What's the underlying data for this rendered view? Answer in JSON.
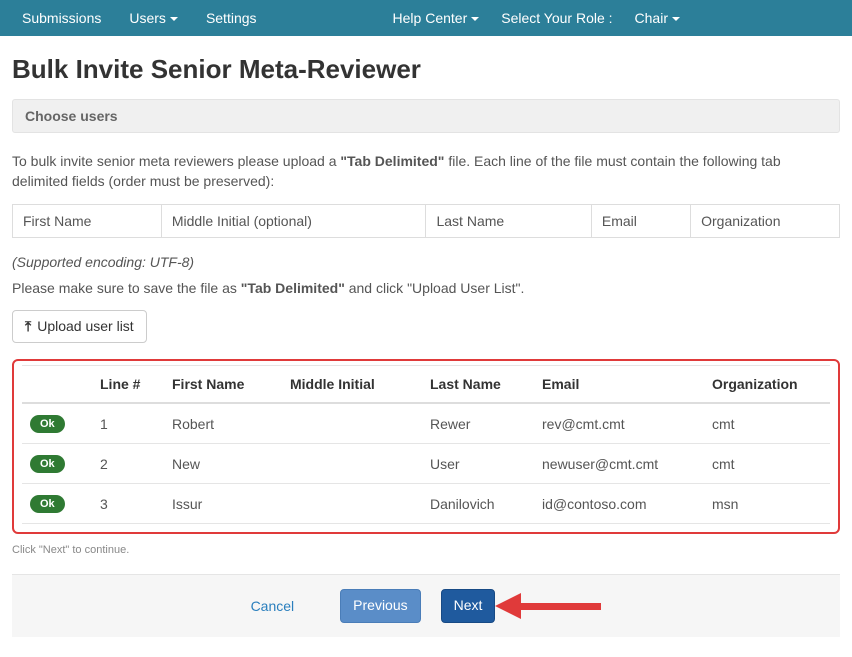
{
  "nav": {
    "submissions": "Submissions",
    "users": "Users",
    "settings": "Settings",
    "help_center": "Help Center",
    "select_role_label": "Select Your Role :",
    "role": "Chair"
  },
  "page": {
    "title": "Bulk Invite Senior Meta-Reviewer",
    "choose_users": "Choose users",
    "instruction_pre": "To bulk invite senior meta reviewers please upload a ",
    "instruction_bold": "\"Tab Delimited\"",
    "instruction_post": " file. Each line of the file must contain the following tab delimited fields (order must be preserved):",
    "fields": {
      "first_name": "First Name",
      "middle_initial": "Middle Initial (optional)",
      "last_name": "Last Name",
      "email": "Email",
      "organization": "Organization"
    },
    "encoding": "(Supported encoding: UTF-8)",
    "save_note_pre": "Please make sure to save the file as ",
    "save_note_bold": "\"Tab Delimited\"",
    "save_note_post": " and click \"Upload User List\".",
    "upload_button": "Upload user list",
    "hint": "Click \"Next\" to continue."
  },
  "table": {
    "headers": {
      "status": "",
      "line": "Line #",
      "first": "First Name",
      "middle": "Middle Initial",
      "last": "Last Name",
      "email": "Email",
      "org": "Organization"
    },
    "rows": [
      {
        "status": "Ok",
        "line": "1",
        "first": "Robert",
        "middle": "",
        "last": "Rewer",
        "email": "rev@cmt.cmt",
        "org": "cmt"
      },
      {
        "status": "Ok",
        "line": "2",
        "first": "New",
        "middle": "",
        "last": "User",
        "email": "newuser@cmt.cmt",
        "org": "cmt"
      },
      {
        "status": "Ok",
        "line": "3",
        "first": "Issur",
        "middle": "",
        "last": "Danilovich",
        "email": "id@contoso.com",
        "org": "msn"
      }
    ]
  },
  "footer": {
    "cancel": "Cancel",
    "previous": "Previous",
    "next": "Next"
  }
}
